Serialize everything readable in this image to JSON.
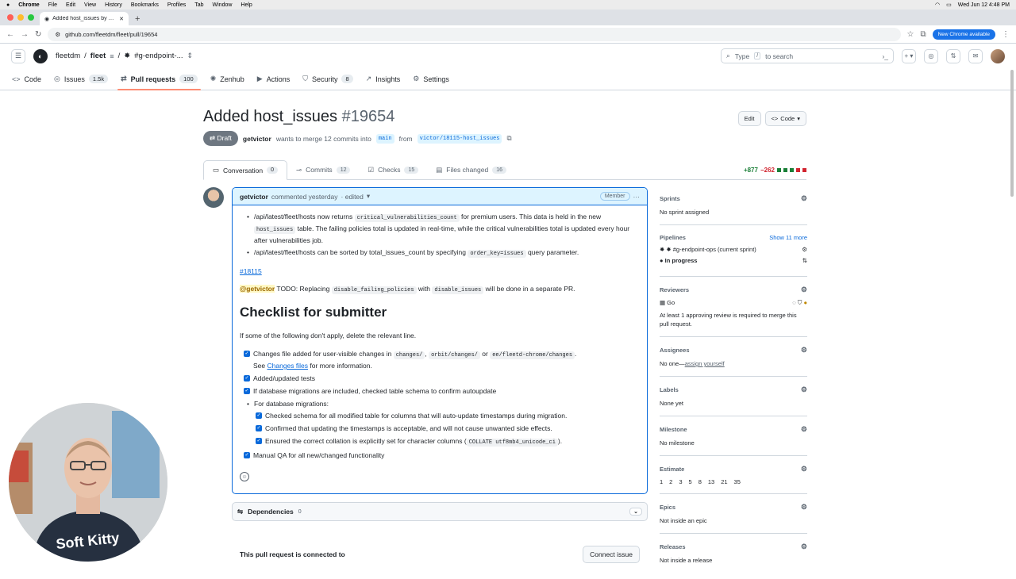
{
  "menubar": {
    "app": "Chrome",
    "items": [
      "File",
      "Edit",
      "View",
      "History",
      "Bookmarks",
      "Profiles",
      "Tab",
      "Window",
      "Help"
    ],
    "clock": "Wed Jun 12  4:48 PM"
  },
  "browser": {
    "tab_title": "Added host_issues by getvic",
    "url": "github.com/fleetdm/fleet/pull/19654",
    "new_chrome": "New Chrome available"
  },
  "header": {
    "owner": "fleetdm",
    "repo": "fleet",
    "project": "#g-endpoint-...",
    "search_pre": "Type",
    "search_key": "/",
    "search_post": "to search"
  },
  "repo_nav": [
    {
      "label": "Code",
      "count": ""
    },
    {
      "label": "Issues",
      "count": "1.5k"
    },
    {
      "label": "Pull requests",
      "count": "100"
    },
    {
      "label": "Zenhub",
      "count": ""
    },
    {
      "label": "Actions",
      "count": ""
    },
    {
      "label": "Security",
      "count": "8"
    },
    {
      "label": "Insights",
      "count": ""
    },
    {
      "label": "Settings",
      "count": ""
    }
  ],
  "pr": {
    "title": "Added host_issues",
    "number": "#19654",
    "edit_label": "Edit",
    "code_label": "Code",
    "state": "Draft",
    "author": "getvictor",
    "merge_text": "wants to merge 12 commits into",
    "base": "main",
    "from_text": "from",
    "head": "victor/18115-host_issues"
  },
  "tabs": [
    {
      "label": "Conversation",
      "count": "0"
    },
    {
      "label": "Commits",
      "count": "12"
    },
    {
      "label": "Checks",
      "count": "15"
    },
    {
      "label": "Files changed",
      "count": "16"
    }
  ],
  "diffstat": {
    "add": "+877",
    "del": "−262"
  },
  "comment": {
    "author": "getvictor",
    "when": "commented yesterday",
    "edited": "· edited",
    "badge": "Member",
    "b1_a": "/api/latest/fleet/hosts now returns",
    "b1_code": "critical_vulnerabilities_count",
    "b1_b": "for premium users. This data is held in the new",
    "b1_code2": "host_issues",
    "b1_c": "table. The failing policies total is updated in real-time, while the critical vulnerabilities total is updated every hour after vulnerabilities job.",
    "b2_a": "/api/latest/fleet/hosts can be sorted by total_issues_count by specifying",
    "b2_code": "order_key=issues",
    "b2_b": "query parameter.",
    "issue_link": "#18115",
    "mention": "@getvictor",
    "todo_a": "TODO: Replacing",
    "todo_code1": "disable_failing_policies",
    "todo_b": "with",
    "todo_code2": "disable_issues",
    "todo_c": "will be done in a separate PR.",
    "heading": "Checklist for submitter",
    "intro": "If some of the following don't apply, delete the relevant line.",
    "c1_a": "Changes file added for user-visible changes in",
    "c1_code1": "changes/",
    "c1_code2": "orbit/changes/",
    "c1_or": "or",
    "c1_code3": "ee/fleetd-chrome/changes",
    "c1_see": "See",
    "c1_link": "Changes files",
    "c1_more": "for more information.",
    "c2": "Added/updated tests",
    "c3": "If database migrations are included, checked table schema to confirm autoupdate",
    "c4": "For database migrations:",
    "c4a": "Checked schema for all modified table for columns that will auto-update timestamps during migration.",
    "c4b": "Confirmed that updating the timestamps is acceptable, and will not cause unwanted side effects.",
    "c4c_a": "Ensured the correct collation is explicitly set for character columns (",
    "c4c_code": "COLLATE utf8mb4_unicode_ci",
    "c4c_b": ").",
    "c5": "Manual QA for all new/changed functionality"
  },
  "deps": {
    "label": "Dependencies",
    "count": "0"
  },
  "connect": {
    "text": "This pull request is connected to",
    "button": "Connect issue"
  },
  "sidebar": {
    "sprints": {
      "title": "Sprints",
      "value": "No sprint assigned"
    },
    "pipelines": {
      "title": "Pipelines",
      "more": "Show 11 more",
      "pipe": "#g-endpoint-ops (current sprint)",
      "status": "In progress"
    },
    "reviewers": {
      "title": "Reviewers",
      "reviewer": "Go",
      "note": "At least 1 approving review is required to merge this pull request."
    },
    "assignees": {
      "title": "Assignees",
      "value": "No one—",
      "link": "assign yourself"
    },
    "labels": {
      "title": "Labels",
      "value": "None yet"
    },
    "milestone": {
      "title": "Milestone",
      "value": "No milestone"
    },
    "estimate": {
      "title": "Estimate",
      "values": [
        "1",
        "2",
        "3",
        "5",
        "8",
        "13",
        "21",
        "35"
      ]
    },
    "epics": {
      "title": "Epics",
      "value": "Not inside an epic"
    },
    "releases": {
      "title": "Releases",
      "value": "Not inside a release"
    }
  },
  "colors": {
    "accent": "#0969da",
    "draft": "#6e7781",
    "add": "#1a7f37",
    "del": "#d1242f",
    "tab_underline": "#fd8c73"
  }
}
